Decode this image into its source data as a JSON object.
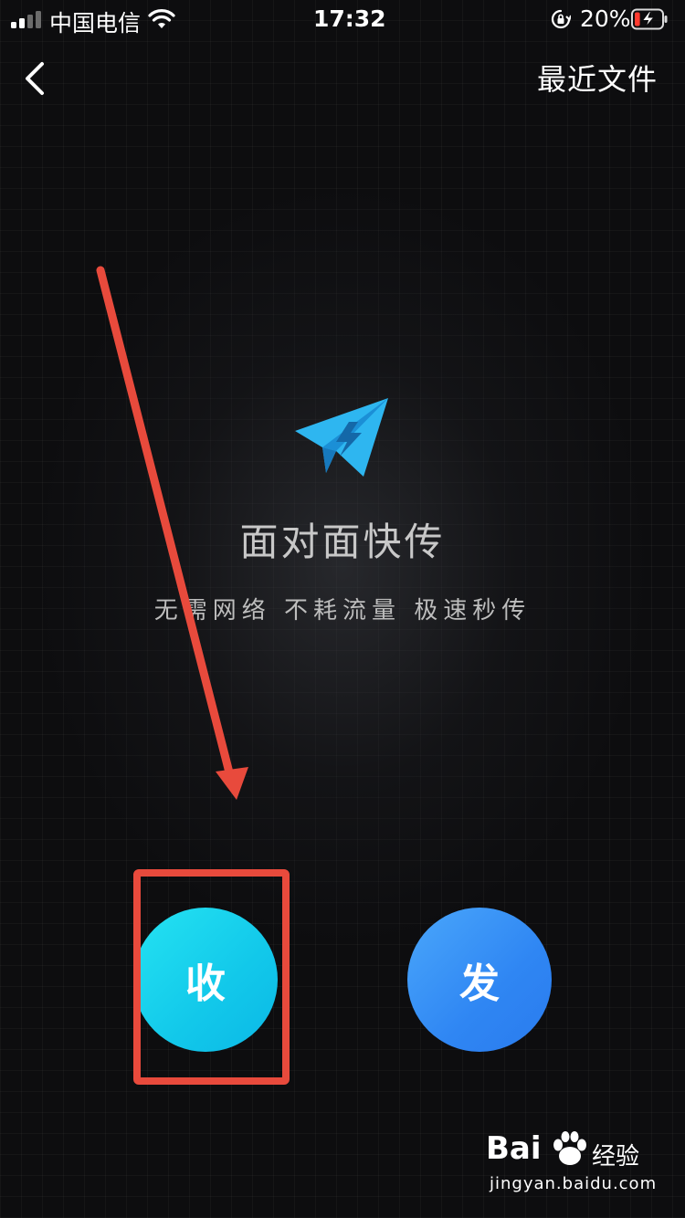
{
  "status_bar": {
    "carrier": "中国电信",
    "time": "17:32",
    "battery_percent": "20%",
    "battery_level": 0.2,
    "signal_bars_active": 2,
    "signal_bars_total": 4,
    "icons": [
      "signal-icon",
      "wifi-icon",
      "rotation-lock-icon",
      "battery-charging-icon"
    ]
  },
  "nav": {
    "back_icon": "chevron-left-icon",
    "right_action": "最近文件"
  },
  "hero": {
    "icon": "paper-plane-lightning-icon",
    "title": "面对面快传",
    "subtitle": "无需网络 不耗流量 极速秒传"
  },
  "actions": {
    "receive_label": "收",
    "send_label": "发"
  },
  "watermark": {
    "brand": "Bai",
    "brand_suffix": "经验",
    "url": "jingyan.baidu.com"
  },
  "colors": {
    "background": "#0d0d0f",
    "receive_button": "#1cd4ee",
    "send_button": "#3590f5",
    "plane_icon": "#2eb6f0",
    "annotation": "#e84a3c"
  }
}
